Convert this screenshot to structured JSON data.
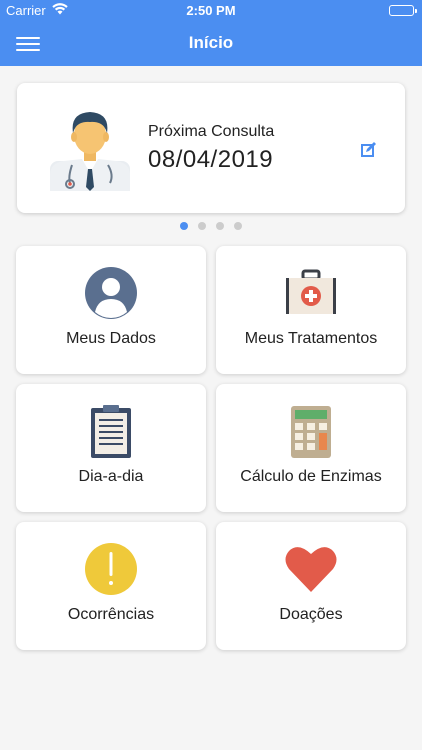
{
  "status_bar": {
    "carrier": "Carrier",
    "time": "2:50 PM"
  },
  "nav": {
    "title": "Início",
    "menu_icon": "hamburger-icon"
  },
  "next_appointment": {
    "label": "Próxima Consulta",
    "date": "08/04/2019",
    "icon": "doctor-avatar-icon",
    "edit_icon": "edit-icon"
  },
  "carousel": {
    "pages": 4,
    "active_index": 0
  },
  "tiles": [
    {
      "label": "Meus Dados",
      "icon": "user-avatar-icon"
    },
    {
      "label": "Meus Tratamentos",
      "icon": "first-aid-kit-icon"
    },
    {
      "label": "Dia-a-dia",
      "icon": "clipboard-icon"
    },
    {
      "label": "Cálculo de Enzimas",
      "icon": "calculator-icon"
    },
    {
      "label": "Ocorrências",
      "icon": "warning-icon"
    },
    {
      "label": "Doações",
      "icon": "heart-icon"
    }
  ],
  "colors": {
    "primary": "#4b8ef1",
    "background": "#f5f5f5",
    "card": "#ffffff",
    "heart": "#e25b4a",
    "warning": "#efc93a"
  }
}
